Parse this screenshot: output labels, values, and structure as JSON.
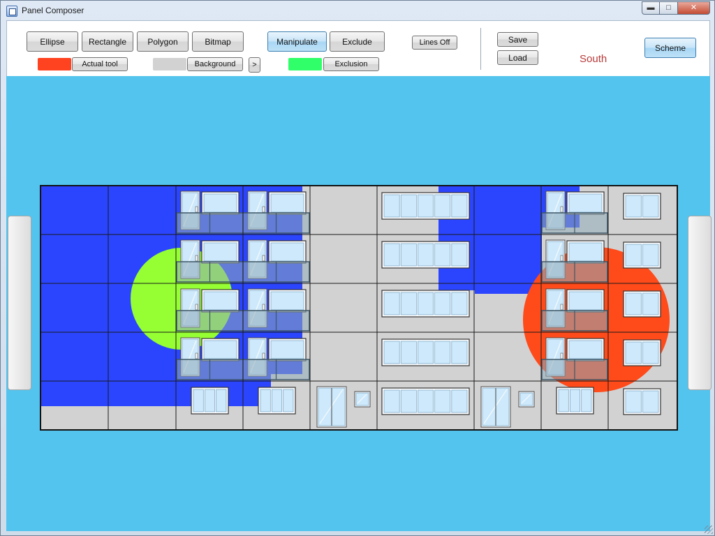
{
  "window": {
    "title": "Panel Composer"
  },
  "toolbar": {
    "shape_tools": [
      "Ellipse",
      "Rectangle",
      "Polygon",
      "Bitmap"
    ],
    "manipulate_label": "Manipulate",
    "exclude_label": "Exclude",
    "lines_label": "Lines Off",
    "save_label": "Save",
    "load_label": "Load",
    "scheme_label": "Scheme",
    "orientation_label": "South",
    "actual_tool_label": "Actual tool",
    "background_label": "Background",
    "next_label": ">",
    "exclusion_label": "Exclusion"
  },
  "colors": {
    "actual_tool": "#ff4220",
    "background": "#d2d2d2",
    "exclusion": "#31ff6a",
    "canvas_bg": "#53c4ee",
    "facade_panel": "#d2d2d2",
    "blue_region": "#2b45ff",
    "green_shape": "#95ff33",
    "red_shape": "#ff4a1a"
  },
  "facade": {
    "column_widths": [
      97,
      97,
      96,
      96,
      96,
      139,
      96,
      96,
      97
    ],
    "rows": 5,
    "cells": [
      [
        "blank",
        "blank",
        "door-window",
        "door-window",
        "blank",
        "wide-window",
        "blank",
        "door-window",
        "window"
      ],
      [
        "blank",
        "blank",
        "door-window",
        "door-window",
        "blank",
        "wide-window",
        "blank",
        "door-window",
        "window"
      ],
      [
        "blank",
        "blank",
        "door-window",
        "door-window",
        "blank",
        "wide-window",
        "blank",
        "door-window",
        "window"
      ],
      [
        "blank",
        "blank",
        "door-window",
        "door-window",
        "blank",
        "wide-window",
        "blank",
        "door-window",
        "window"
      ],
      [
        "blank",
        "blank",
        "triple-window",
        "triple-window",
        "entrance",
        "wide-window",
        "entrance",
        "triple-window",
        "window"
      ]
    ],
    "balcony_rows": [
      0,
      1,
      2,
      3
    ],
    "balcony_groups": [
      [
        2,
        3
      ],
      [
        7
      ]
    ]
  }
}
